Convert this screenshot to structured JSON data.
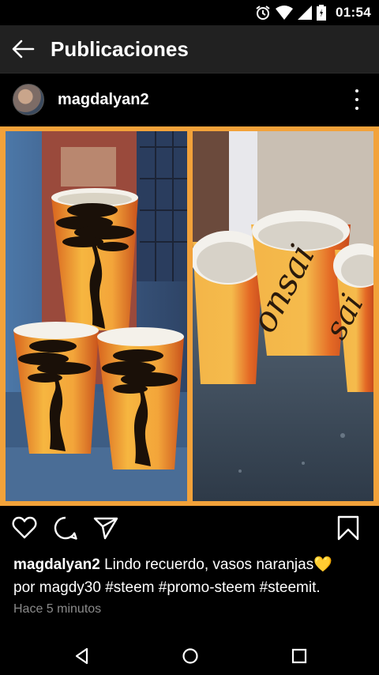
{
  "status": {
    "time": "01:54"
  },
  "app_bar": {
    "title": "Publicaciones"
  },
  "post": {
    "username": "magdalyan2",
    "caption": {
      "user": "magdalyan2",
      "text": "Lindo recuerdo, vasos  naranjas",
      "emoji": "💛",
      "by": "por magdy30",
      "tags": [
        "#steem",
        "#promo-steem",
        "#steemit."
      ]
    },
    "timestamp": "Hace 5 minutos",
    "cup_text": "onsai"
  },
  "icons": {
    "back": "arrow-left-icon",
    "more": "more-vert-icon",
    "like": "heart-icon",
    "comment": "comment-icon",
    "share": "send-icon",
    "save": "bookmark-icon"
  },
  "colors": {
    "frame": "#f2a23a",
    "appbar": "#212121",
    "timestamp": "#8a8a8a"
  }
}
